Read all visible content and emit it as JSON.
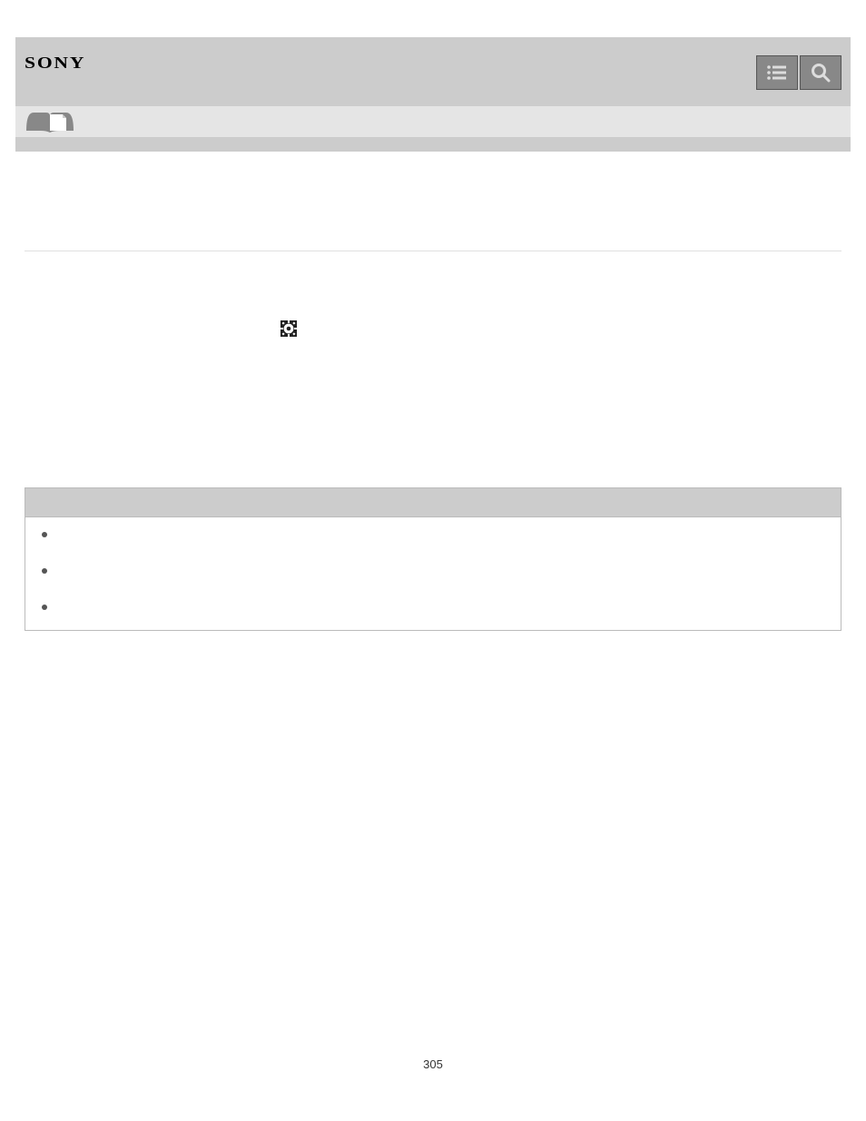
{
  "brand": "SONY",
  "header": {
    "menu_label": "menu",
    "search_label": "search"
  },
  "breadcrumb": "",
  "page_title": "",
  "step1": {
    "number": "",
    "text_before_icon": "",
    "text_after_icon": ""
  },
  "subsequent_text": "",
  "note": {
    "heading": "",
    "items": [
      "",
      "",
      ""
    ]
  },
  "page_number": "305"
}
